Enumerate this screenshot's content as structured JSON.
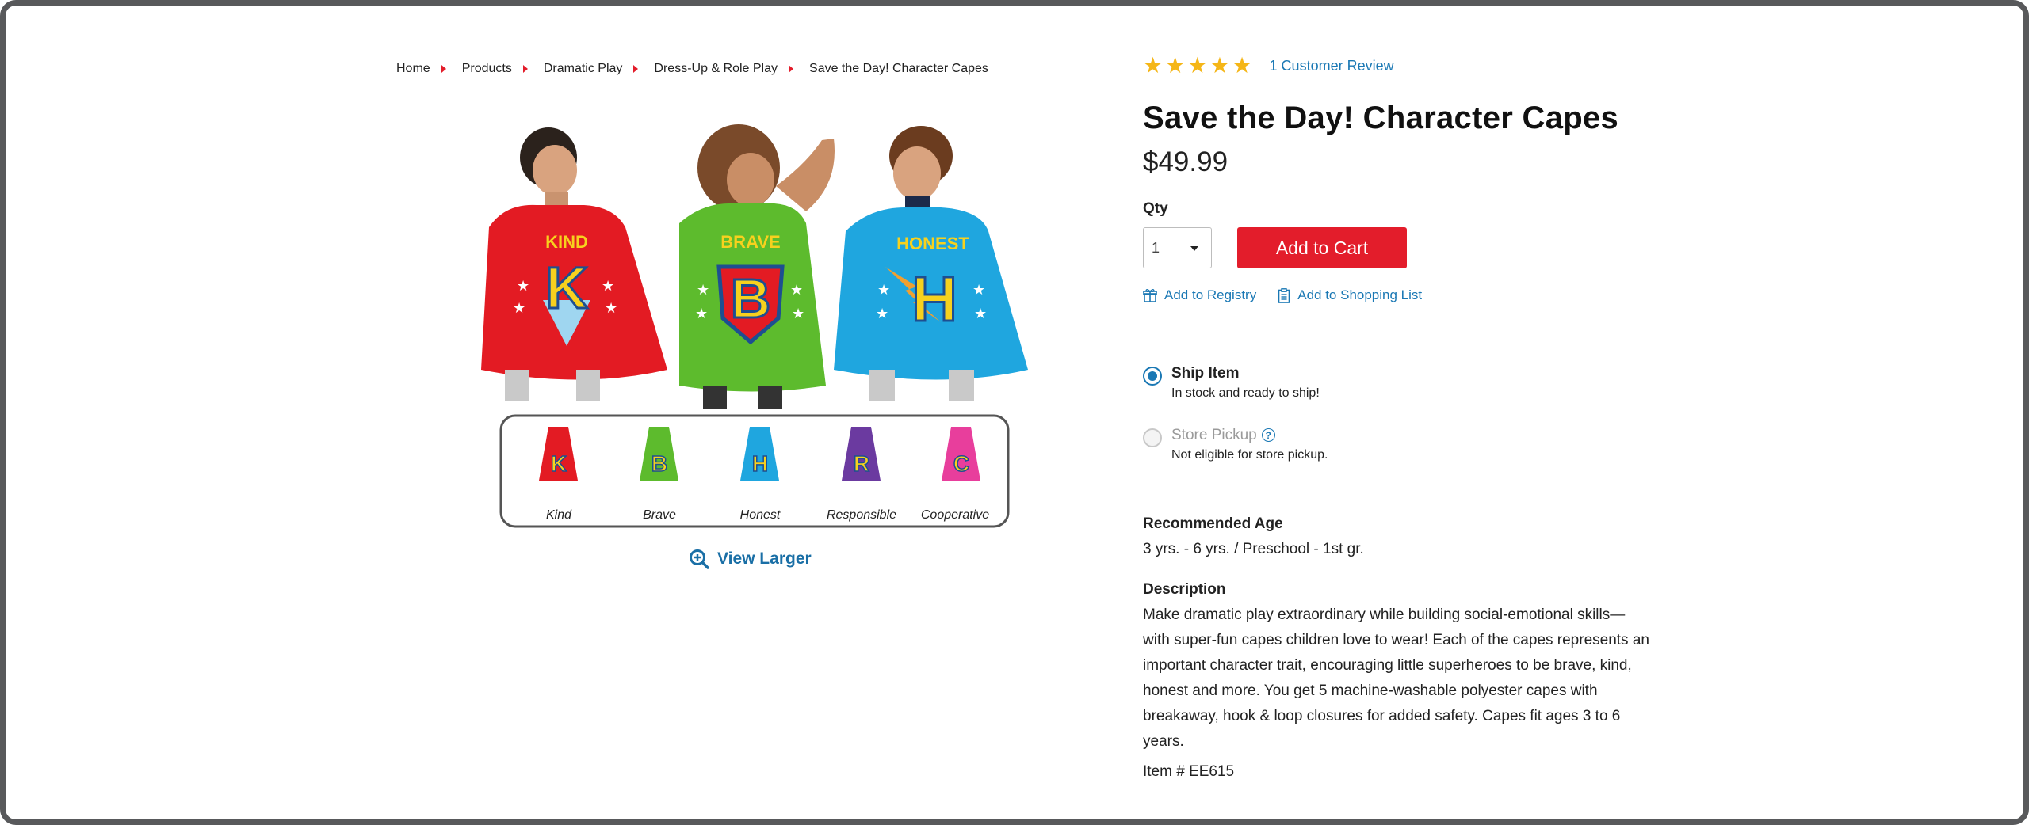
{
  "breadcrumb": {
    "items": [
      "Home",
      "Products",
      "Dramatic Play",
      "Dress-Up & Role Play"
    ],
    "current": "Save the Day! Character Capes"
  },
  "product": {
    "image": {
      "capes": [
        {
          "letter": "K",
          "word": "KIND",
          "color": "#e31b23"
        },
        {
          "letter": "B",
          "word": "BRAVE",
          "color": "#5dbb2d"
        },
        {
          "letter": "H",
          "word": "HONEST",
          "color": "#1fa6df"
        }
      ],
      "inset": [
        {
          "letter": "K",
          "label": "Kind",
          "color": "#e31b23"
        },
        {
          "letter": "B",
          "label": "Brave",
          "color": "#5dbb2d"
        },
        {
          "letter": "H",
          "label": "Honest",
          "color": "#1fa6df"
        },
        {
          "letter": "R",
          "label": "Responsible",
          "color": "#6b3aa0"
        },
        {
          "letter": "C",
          "label": "Cooperative",
          "color": "#e83e9c"
        }
      ]
    },
    "view_larger": "View Larger",
    "rating": {
      "stars": 5,
      "max": 5,
      "reviews_label": "1 Customer Review"
    },
    "title": "Save the Day! Character Capes",
    "price": "$49.99",
    "qty_label": "Qty",
    "qty_value": "1",
    "add_to_cart": "Add to Cart",
    "add_to_registry": "Add to Registry",
    "add_to_shopping_list": "Add to Shopping List",
    "ship": {
      "title": "Ship Item",
      "sub": "In stock and ready to ship!"
    },
    "pickup": {
      "title": "Store Pickup",
      "sub": "Not eligible for store pickup."
    },
    "age_heading": "Recommended Age",
    "age_value": "3 yrs. - 6 yrs. / Preschool - 1st gr.",
    "description_heading": "Description",
    "description": "Make dramatic play extraordinary while building social-emotional skills—with super-fun capes children love to wear! Each of the capes represents an important character trait, encouraging little superheroes to be brave, kind, honest and more. You get 5 machine-washable polyester capes with breakaway, hook & loop closures for added safety. Capes fit ages 3 to 6 years.",
    "item_number": "Item # EE615"
  },
  "colors": {
    "accent_red": "#e31d2b",
    "link_blue": "#1a78b4",
    "star_gold": "#f5b617"
  }
}
